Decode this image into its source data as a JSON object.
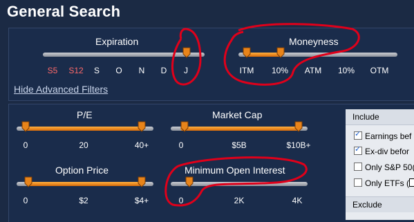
{
  "page": {
    "title": "General Search"
  },
  "expiration": {
    "label": "Expiration",
    "ticks": [
      "S5",
      "S12",
      "S",
      "O",
      "N",
      "D",
      "J"
    ],
    "red_ticks": [
      0,
      1
    ]
  },
  "moneyness": {
    "label": "Moneyness",
    "ticks": [
      "ITM",
      "10%",
      "ATM",
      "10%",
      "OTM"
    ]
  },
  "advanced_link": "Hide Advanced Filters",
  "pe": {
    "label": "P/E",
    "ticks": [
      "0",
      "20",
      "40+"
    ]
  },
  "market_cap": {
    "label": "Market Cap",
    "ticks": [
      "0",
      "$5B",
      "$10B+"
    ]
  },
  "option_price": {
    "label": "Option Price",
    "ticks": [
      "0",
      "$2",
      "$4+"
    ]
  },
  "min_open_interest": {
    "label": "Minimum Open Interest",
    "ticks": [
      "0",
      "2K",
      "4K"
    ]
  },
  "include": {
    "header": "Include",
    "items": [
      {
        "label": "Earnings bef",
        "checked": true
      },
      {
        "label": "Ex-div befor",
        "checked": true
      },
      {
        "label": "Only S&P 50(",
        "checked": false
      },
      {
        "label": "Only ETFs (",
        "checked": false
      }
    ]
  },
  "exclude": {
    "header": "Exclude"
  },
  "colors": {
    "background": "#1b2a44",
    "slider_fill": "#e8841a",
    "annotation": "#e0001a",
    "red_tick": "#ff6a6a"
  }
}
